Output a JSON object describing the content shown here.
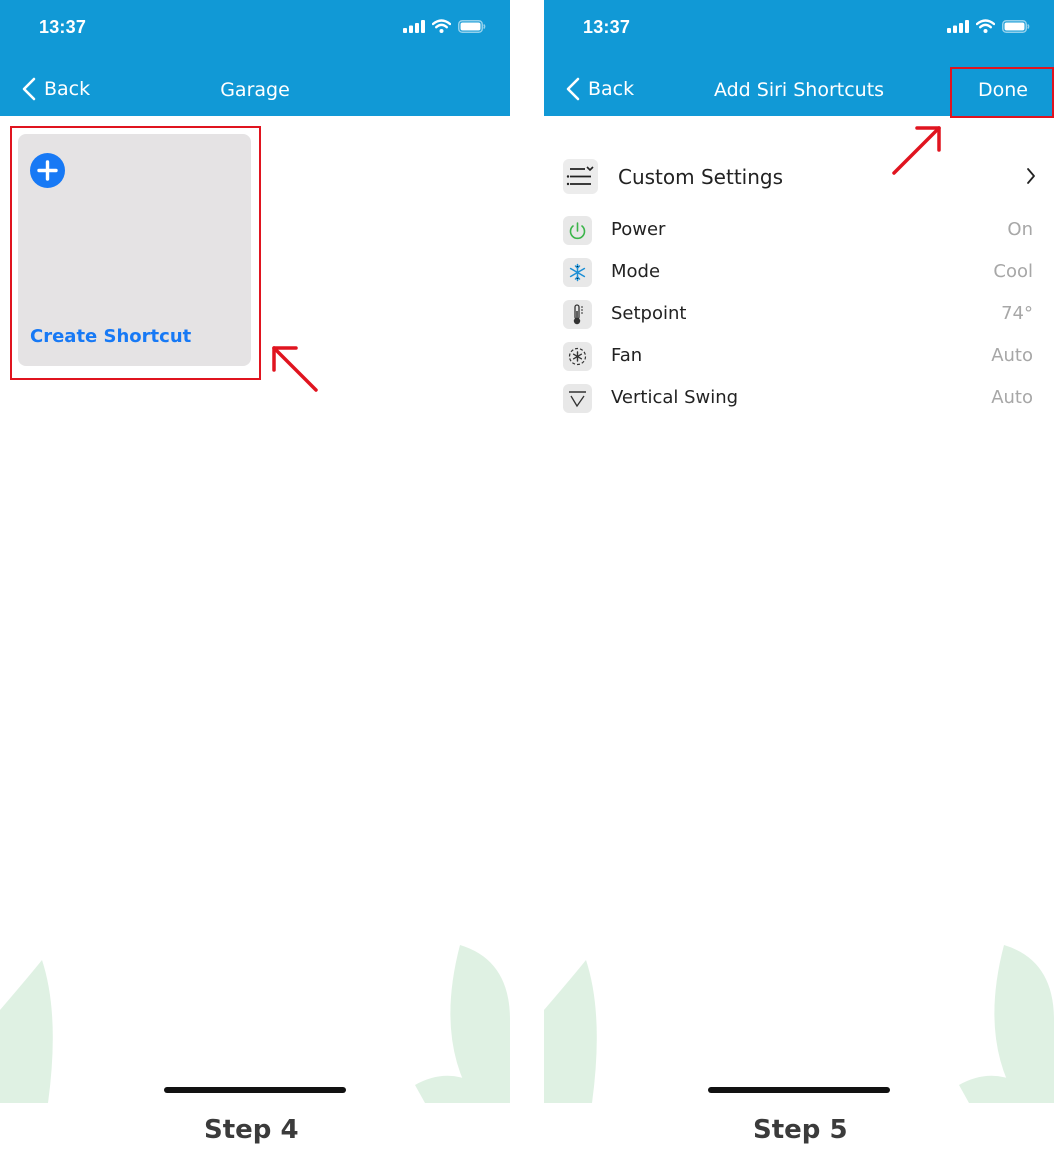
{
  "left_screen": {
    "status": {
      "time": "13:37"
    },
    "nav": {
      "back_label": "Back",
      "title": "Garage"
    },
    "tile": {
      "label": "Create Shortcut"
    },
    "step_label": "Step 4"
  },
  "right_screen": {
    "status": {
      "time": "13:37"
    },
    "nav": {
      "back_label": "Back",
      "title": "Add Siri Shortcuts",
      "done_label": "Done"
    },
    "custom_settings": {
      "label": "Custom Settings",
      "icon": "sliders-icon"
    },
    "settings": [
      {
        "label": "Power",
        "value": "On",
        "icon": "power-icon"
      },
      {
        "label": "Mode",
        "value": "Cool",
        "icon": "snowflake-icon"
      },
      {
        "label": "Setpoint",
        "value": "74°",
        "icon": "thermometer-icon"
      },
      {
        "label": "Fan",
        "value": "Auto",
        "icon": "fan-icon"
      },
      {
        "label": "Vertical Swing",
        "value": "Auto",
        "icon": "vertical-swing-icon"
      }
    ],
    "step_label": "Step 5"
  },
  "colors": {
    "header": "#1199d6",
    "highlight": "#e0141f",
    "accent_blue": "#1779f5",
    "tile_bg": "#e5e3e4",
    "leaf": "#dff1e3",
    "value_gray": "#a7a7a7"
  }
}
